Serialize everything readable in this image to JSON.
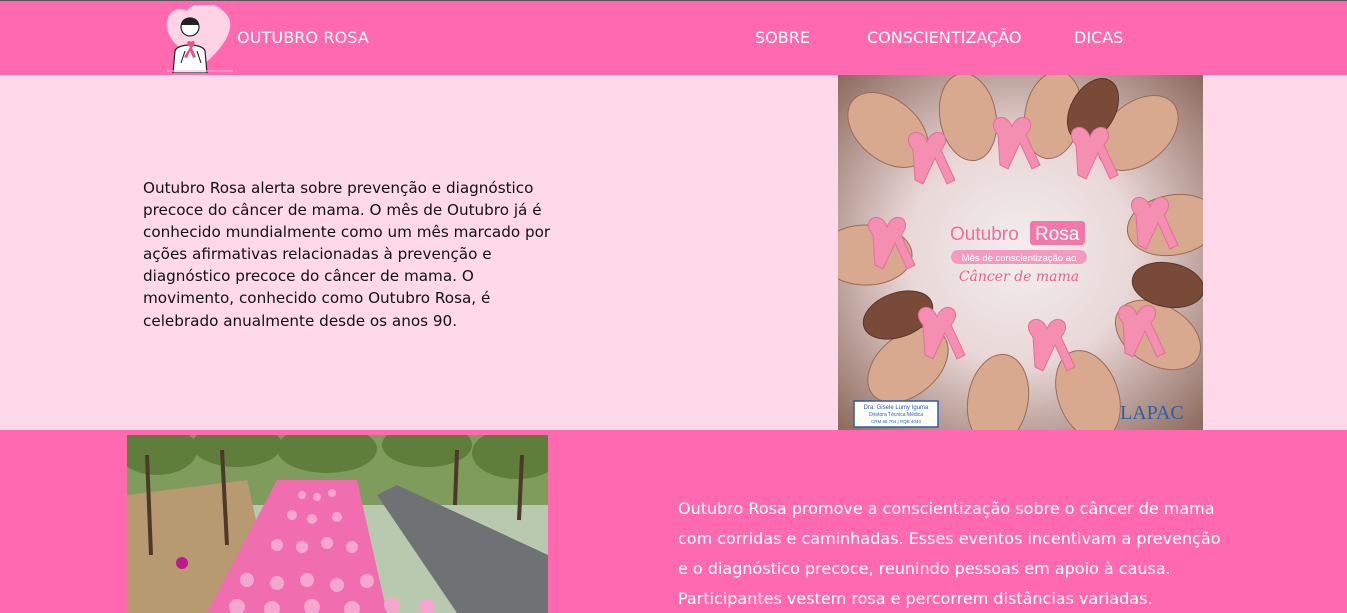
{
  "header": {
    "brand": "OUTUBRO ROSA",
    "nav": [
      {
        "label": "SOBRE"
      },
      {
        "label": "CONSCIENTIZAÇÃO"
      },
      {
        "label": "DICAS"
      }
    ]
  },
  "section1": {
    "text": "Outubro Rosa alerta sobre prevenção e diagnóstico precoce do câncer de mama. O mês de Outubro já é conhecido mundialmente como um mês marcado por ações afirmativas relacionadas à prevenção e diagnóstico precoce do câncer de mama. O movimento, conhecido como Outubro Rosa, é celebrado anualmente desde os anos 90.",
    "image": {
      "title_word1": "Outubro",
      "title_word2": "Rosa",
      "subtitle": "Mês de conscientização ao",
      "script": "Câncer de mama",
      "badge_line1": "Dra. Gisele Lumy Iguma",
      "badge_line2": "Diretora Técnica Médica",
      "badge_line3": "CRM 65.704 | RQE 4040",
      "lab_logo": "LAPAC"
    }
  },
  "section2": {
    "text": "Outubro Rosa promove a conscientização sobre o câncer de mama com corridas e caminhadas. Esses eventos incentivam a prevenção e o diagnóstico precoce, reunindo pessoas em apoio à causa. Participantes vestem rosa e percorrem distâncias variadas."
  },
  "colors": {
    "header_bg": "#ff69b0",
    "section1_bg": "#ffd9ea",
    "section2_bg": "#ff69b0",
    "ribbon": "#f48fb1"
  }
}
